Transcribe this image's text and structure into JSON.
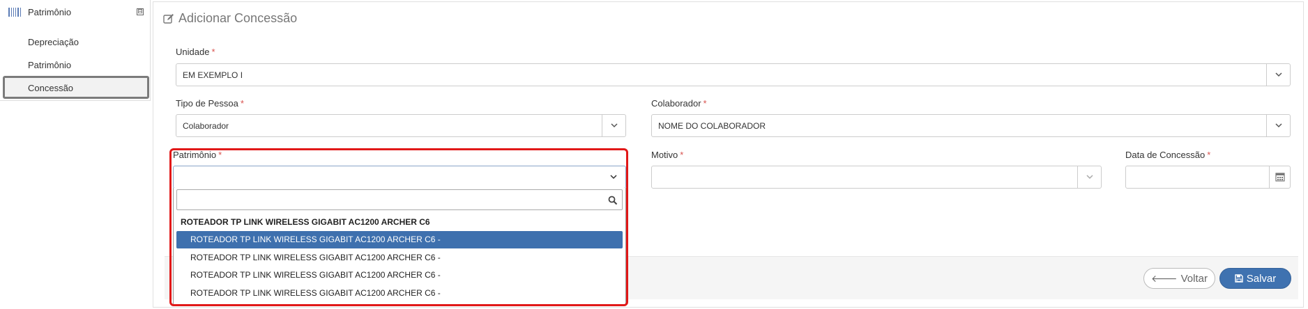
{
  "sidebar": {
    "title": "Patrimônio",
    "collapse": "⊟",
    "items": [
      {
        "label": "Depreciação"
      },
      {
        "label": "Patrimônio"
      },
      {
        "label": "Concessão"
      }
    ]
  },
  "page": {
    "title": "Adicionar Concessão"
  },
  "form": {
    "required_mark": "*",
    "unidade": {
      "label": "Unidade",
      "value": "EM EXEMPLO I"
    },
    "tipo_pessoa": {
      "label": "Tipo de Pessoa",
      "value": "Colaborador"
    },
    "colaborador": {
      "label": "Colaborador",
      "value": "NOME DO COLABORADOR"
    },
    "patrimonio": {
      "label": "Patrimônio",
      "value": ""
    },
    "motivo": {
      "label": "Motivo",
      "value": ""
    },
    "data_concessao": {
      "label": "Data de Concessão",
      "value": ""
    }
  },
  "dropdown": {
    "search_value": "",
    "group_label": "ROTEADOR TP LINK WIRELESS GIGABIT AC1200 ARCHER C6",
    "options": [
      {
        "label": "ROTEADOR TP LINK WIRELESS GIGABIT AC1200 ARCHER C6 -",
        "selected": true
      },
      {
        "label": "ROTEADOR TP LINK WIRELESS GIGABIT AC1200 ARCHER C6 -",
        "selected": false
      },
      {
        "label": "ROTEADOR TP LINK WIRELESS GIGABIT AC1200 ARCHER C6 -",
        "selected": false
      },
      {
        "label": "ROTEADOR TP LINK WIRELESS GIGABIT AC1200 ARCHER C6 -",
        "selected": false
      }
    ]
  },
  "buttons": {
    "back": {
      "label": "Voltar",
      "icon": "arrow-left-icon"
    },
    "save": {
      "label": "Salvar",
      "icon": "floppy-disk-icon"
    }
  },
  "colors": {
    "primary": "#3f72b0",
    "required": "#d9534f",
    "highlight": "#e11818"
  }
}
